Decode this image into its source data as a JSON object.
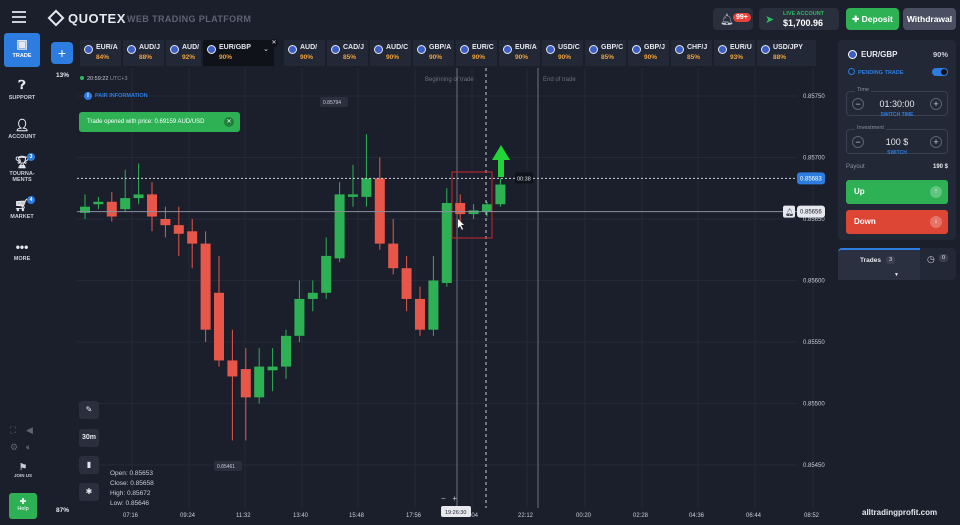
{
  "header": {
    "logo": "QUOTEX",
    "platform": "WEB TRADING PLATFORM",
    "notif_count": "99+",
    "account_label": "LIVE ACCOUNT",
    "balance": "$1,700.96",
    "deposit": "Deposit",
    "withdrawal": "Withdrawal"
  },
  "nav": {
    "trade": "TRADE",
    "support": "SUPPORT",
    "account": "ACCOUNT",
    "tournaments": "TOURNA-MENTS",
    "tournaments_badge": "3",
    "market": "MARKET",
    "market_badge": "4",
    "more": "MORE",
    "join": "JOIN US",
    "help": "Help"
  },
  "tabs": [
    {
      "name": "EUR/A",
      "pct": "84%"
    },
    {
      "name": "AUD/J",
      "pct": "88%"
    },
    {
      "name": "AUD/",
      "pct": "92%"
    },
    {
      "name": "EUR/GBP",
      "pct": "90%",
      "active": true
    },
    {
      "name": "AUD/",
      "pct": "90%"
    },
    {
      "name": "CAD/J",
      "pct": "85%"
    },
    {
      "name": "AUD/C",
      "pct": "90%"
    },
    {
      "name": "GBP/A",
      "pct": "90%"
    },
    {
      "name": "EUR/C",
      "pct": "90%"
    },
    {
      "name": "EUR/A",
      "pct": "90%"
    },
    {
      "name": "USD/C",
      "pct": "90%"
    },
    {
      "name": "GBP/C",
      "pct": "85%"
    },
    {
      "name": "GBP/J",
      "pct": "90%"
    },
    {
      "name": "CHF/J",
      "pct": "85%"
    },
    {
      "name": "EUR/U",
      "pct": "93%"
    },
    {
      "name": "USD/JPY",
      "pct": "88%"
    }
  ],
  "chart_info": {
    "server_time": "20:59:22",
    "utc": "UTC+3",
    "pair_info": "PAIR INFORMATION",
    "toast": "Trade opened with price: 0.69159 AUD/USD",
    "pct_top": "13%",
    "pct_bottom": "87%",
    "timeframe": "30m",
    "begin_label": "Beginning of trade",
    "end_label": "End of trade",
    "countdown": "00:38",
    "current_time_label": "19:26:30",
    "ohlc": {
      "open": "Open:  0.85653",
      "close": "Close:  0.85658",
      "high": "High:  0.85672",
      "low": "Low:  0.85646"
    }
  },
  "chart_data": {
    "type": "candlestick",
    "price_labels": [
      "0.85750",
      "0.85700",
      "0.85650",
      "0.85600",
      "0.85550",
      "0.85500",
      "0.85450"
    ],
    "time_labels": [
      "07:16",
      "09:24",
      "11:32",
      "13:40",
      "15:48",
      "17:56",
      "20:04",
      "22:12",
      "00:20",
      "02:28",
      "04:36",
      "06:44",
      "08:52"
    ],
    "current_price": "0.85683",
    "trade_price": "0.85656",
    "high_marker": "0.85794",
    "low_marker": "0.85461",
    "candles": [
      {
        "o": 0.85655,
        "c": 0.8566,
        "h": 0.8567,
        "l": 0.8565
      },
      {
        "o": 0.85662,
        "c": 0.85664,
        "h": 0.85668,
        "l": 0.85658
      },
      {
        "o": 0.85664,
        "c": 0.85652,
        "h": 0.85672,
        "l": 0.85648
      },
      {
        "o": 0.85658,
        "c": 0.85667,
        "h": 0.8569,
        "l": 0.85656
      },
      {
        "o": 0.85667,
        "c": 0.8567,
        "h": 0.85695,
        "l": 0.85662
      },
      {
        "o": 0.8567,
        "c": 0.85652,
        "h": 0.8568,
        "l": 0.8564
      },
      {
        "o": 0.8565,
        "c": 0.85645,
        "h": 0.8566,
        "l": 0.85635
      },
      {
        "o": 0.85645,
        "c": 0.85638,
        "h": 0.8566,
        "l": 0.8562
      },
      {
        "o": 0.8564,
        "c": 0.8563,
        "h": 0.8565,
        "l": 0.8561
      },
      {
        "o": 0.8563,
        "c": 0.8556,
        "h": 0.8564,
        "l": 0.8555
      },
      {
        "o": 0.8559,
        "c": 0.85535,
        "h": 0.8562,
        "l": 0.8553
      },
      {
        "o": 0.85535,
        "c": 0.85522,
        "h": 0.8556,
        "l": 0.8547
      },
      {
        "o": 0.85528,
        "c": 0.85505,
        "h": 0.85545,
        "l": 0.8547
      },
      {
        "o": 0.85505,
        "c": 0.8553,
        "h": 0.85545,
        "l": 0.855
      },
      {
        "o": 0.85527,
        "c": 0.8553,
        "h": 0.85545,
        "l": 0.8551
      },
      {
        "o": 0.8553,
        "c": 0.85555,
        "h": 0.8556,
        "l": 0.8552
      },
      {
        "o": 0.85555,
        "c": 0.85585,
        "h": 0.856,
        "l": 0.8555
      },
      {
        "o": 0.85585,
        "c": 0.8559,
        "h": 0.856,
        "l": 0.85575
      },
      {
        "o": 0.8559,
        "c": 0.8562,
        "h": 0.85635,
        "l": 0.85585
      },
      {
        "o": 0.85618,
        "c": 0.8567,
        "h": 0.8568,
        "l": 0.85615
      },
      {
        "o": 0.85668,
        "c": 0.8567,
        "h": 0.85694,
        "l": 0.8566
      },
      {
        "o": 0.85668,
        "c": 0.85683,
        "h": 0.85719,
        "l": 0.8566
      },
      {
        "o": 0.85683,
        "c": 0.8563,
        "h": 0.857,
        "l": 0.85625
      },
      {
        "o": 0.8563,
        "c": 0.8561,
        "h": 0.8565,
        "l": 0.85605
      },
      {
        "o": 0.8561,
        "c": 0.85585,
        "h": 0.8562,
        "l": 0.85575
      },
      {
        "o": 0.85585,
        "c": 0.8556,
        "h": 0.85595,
        "l": 0.85555
      },
      {
        "o": 0.8556,
        "c": 0.856,
        "h": 0.8562,
        "l": 0.85555
      },
      {
        "o": 0.85598,
        "c": 0.85663,
        "h": 0.85675,
        "l": 0.85595
      },
      {
        "o": 0.85663,
        "c": 0.85654,
        "h": 0.8567,
        "l": 0.85645
      },
      {
        "o": 0.85654,
        "c": 0.85657,
        "h": 0.85662,
        "l": 0.8565
      },
      {
        "o": 0.85656,
        "c": 0.85662,
        "h": 0.85664,
        "l": 0.85652
      },
      {
        "o": 0.85662,
        "c": 0.85678,
        "h": 0.85683,
        "l": 0.8566
      }
    ]
  },
  "panel": {
    "pair": "EUR/GBP",
    "payout_pct": "90%",
    "pending": "PENDING TRADE",
    "time_label": "Time",
    "time_value": "01:30:00",
    "switch_time": "SWITCH TIME",
    "investment_label": "Investment",
    "investment_value": "100 $",
    "switch": "SWITCH",
    "payout_label": "Payout",
    "payout_value": "190 $",
    "up": "Up",
    "down": "Down",
    "trades": "Trades",
    "trades_count": "3",
    "pending_count": "0"
  },
  "watermark": "alltradingprofit.com",
  "colors": {
    "up": "#2db154",
    "down": "#e8564a",
    "accent": "#2c7ddf",
    "bg": "#1b1f2b"
  }
}
